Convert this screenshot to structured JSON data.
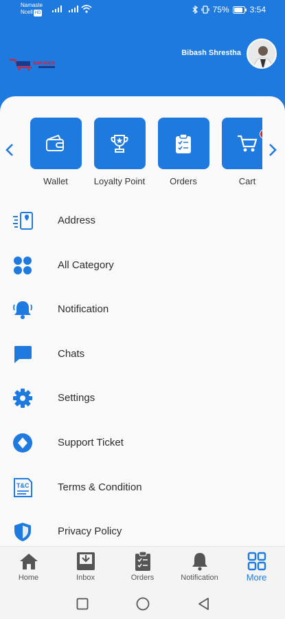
{
  "status_bar": {
    "carrier_line1": "Namaste",
    "carrier_line2": "Ncell",
    "carrier_badge": "HD",
    "battery": "75%",
    "time": "3:54"
  },
  "header": {
    "username": "Bibash Shrestha",
    "logo_text": "BAKAIEN"
  },
  "quick_actions": [
    {
      "label": "Wallet",
      "icon": "wallet-icon"
    },
    {
      "label": "Loyalty Point",
      "icon": "trophy-icon"
    },
    {
      "label": "Orders",
      "icon": "clipboard-icon"
    },
    {
      "label": "Cart",
      "icon": "cart-icon",
      "badge": "0"
    }
  ],
  "menu": [
    {
      "label": "Address",
      "icon": "address-icon"
    },
    {
      "label": "All Category",
      "icon": "category-icon"
    },
    {
      "label": "Notification",
      "icon": "bell-icon"
    },
    {
      "label": "Chats",
      "icon": "chat-icon"
    },
    {
      "label": "Settings",
      "icon": "gear-icon"
    },
    {
      "label": "Support Ticket",
      "icon": "ticket-icon"
    },
    {
      "label": "Terms & Condition",
      "icon": "terms-icon"
    },
    {
      "label": "Privacy Policy",
      "icon": "shield-icon"
    }
  ],
  "bottom_nav": [
    {
      "label": "Home",
      "icon": "home-icon"
    },
    {
      "label": "Inbox",
      "icon": "inbox-icon"
    },
    {
      "label": "Orders",
      "icon": "orders-icon"
    },
    {
      "label": "Notification",
      "icon": "bell-icon"
    },
    {
      "label": "More",
      "icon": "grid-icon",
      "active": true
    }
  ],
  "colors": {
    "primary": "#1f7ae0",
    "badge": "#e11d2d",
    "background": "#fafafa"
  }
}
